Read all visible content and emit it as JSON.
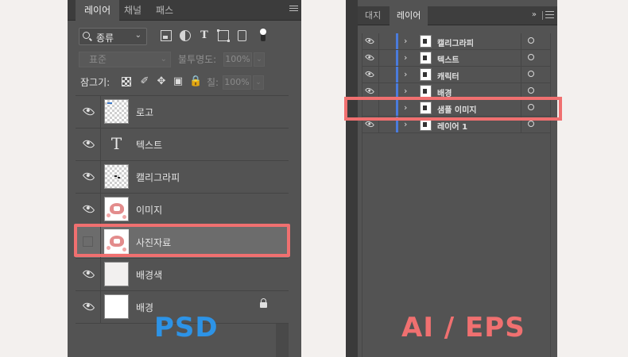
{
  "psd": {
    "tabs": [
      "레이어",
      "채널",
      "패스"
    ],
    "filter_label": "종류",
    "blend_mode": "표준",
    "opacity_label": "불투명도:",
    "opacity_value": "100%",
    "lock_label": "잠그기:",
    "fill_label": "칠:",
    "fill_value": "100%",
    "layers": [
      {
        "name": "로고",
        "visible": true,
        "thumb": "checker"
      },
      {
        "name": "텍스트",
        "visible": true,
        "thumb": "text"
      },
      {
        "name": "캘리그라피",
        "visible": true,
        "thumb": "checker"
      },
      {
        "name": "이미지",
        "visible": true,
        "thumb": "image"
      },
      {
        "name": "사진자료",
        "visible": false,
        "thumb": "image",
        "selected": true
      },
      {
        "name": "배경색",
        "visible": true,
        "thumb": "plain"
      },
      {
        "name": "배경",
        "visible": true,
        "thumb": "white",
        "locked": true
      }
    ],
    "caption": "PSD",
    "caption_color": "#2d93e6"
  },
  "ai": {
    "tabs": [
      "대지",
      "레이어"
    ],
    "layers": [
      {
        "name": "캘리그라피",
        "visible": true
      },
      {
        "name": "텍스트",
        "visible": true
      },
      {
        "name": "캐릭터",
        "visible": true
      },
      {
        "name": "배경",
        "visible": true
      },
      {
        "name": "샘플 이미지",
        "visible": false,
        "highlighted": true
      },
      {
        "name": "레이어 1",
        "visible": true
      }
    ],
    "caption": "AI / EPS",
    "caption_color": "#f07070"
  },
  "highlight_color": "#f07070",
  "layer_bar_color": "#4a7bdc"
}
